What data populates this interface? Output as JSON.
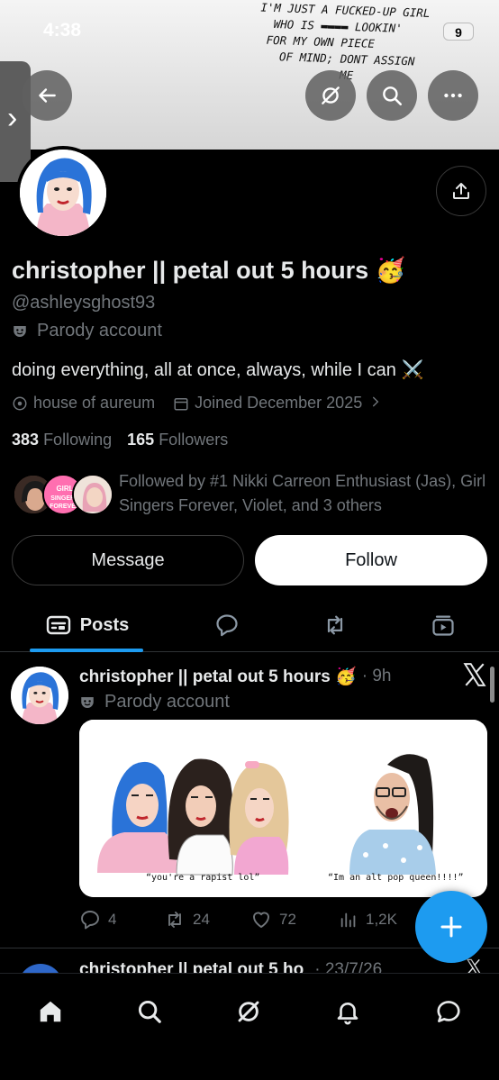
{
  "status_bar": {
    "time": "4:38",
    "battery": "9"
  },
  "banner": {
    "lyrics": "I'M JUST A FUCKED-UP GIRL\n  WHO IS ▬▬▬▬ LOOKIN'\n FOR MY OWN PIECE\n   OF MIND; DONT ASSIGN\n            ME"
  },
  "profile": {
    "display_name": "christopher || petal out 5 hours 🥳",
    "handle": "@ashleysghost93",
    "parody_label": "Parody account",
    "bio": "doing everything, all at once, always, while I can ⚔️",
    "location": "house of aureum",
    "joined": "Joined December 2025",
    "following_count": "383",
    "following_label": "Following",
    "followers_count": "165",
    "followers_label": "Followers",
    "followed_by": "Followed by #1 Nikki Carreon Enthusiast (Jas), Girl Singers Forever, Violet, and 3 others",
    "followed_avatar_text": "GIRL SINGERS FOREVER"
  },
  "buttons": {
    "message": "Message",
    "follow": "Follow"
  },
  "tabs": {
    "posts": "Posts"
  },
  "post": {
    "name": "christopher || petal out 5 hours 🥳",
    "time": "· 9h",
    "parody_label": "Parody account",
    "caption_left": "“you're a rapist lol”",
    "caption_right": "“Im an alt pop queen!!!!”",
    "replies": "4",
    "reposts": "24",
    "likes": "72",
    "views": "1,2K"
  },
  "next_post": {
    "name": "christopher || petal out 5 ho",
    "time": "· 23/7/26"
  },
  "colors": {
    "accent": "#1d9bf0",
    "background": "#000000",
    "secondary_text": "#71767b"
  },
  "icons": [
    "back-arrow-icon",
    "grok-icon",
    "search-icon",
    "more-icon",
    "share-icon",
    "theater-mask-icon",
    "location-icon",
    "calendar-icon",
    "chevron-right-icon",
    "posts-icon",
    "reply-icon",
    "repost-icon",
    "media-icon",
    "like-icon",
    "views-icon",
    "x-logo-icon",
    "plus-icon",
    "home-icon",
    "bell-icon",
    "messages-icon"
  ]
}
